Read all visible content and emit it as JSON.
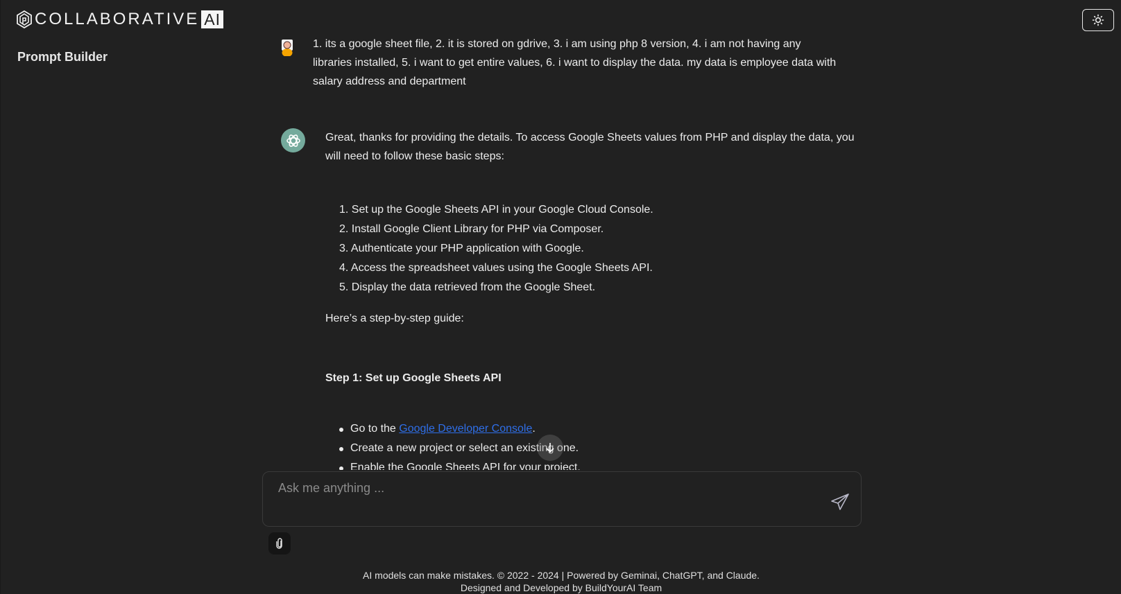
{
  "header": {
    "logo_text": "COLLABORATIVE",
    "logo_badge": "AI",
    "sidebar_title": "Prompt Builder",
    "theme_toggle_icon": "sun-icon"
  },
  "conversation": {
    "user_message": {
      "avatar_icon": "user-avatar-icon",
      "text": "1. its a google sheet file, 2. it is stored on gdrive, 3. i am using php 8 version, 4. i am not having any libraries installed, 5. i want to get entire values, 6. i want to display the data. my data is employee data with salary address and department"
    },
    "assistant_message": {
      "avatar_icon": "openai-logo-icon",
      "intro": "Great, thanks for providing the details. To access Google Sheets values from PHP and display the data, you will need to follow these basic steps:",
      "steps": [
        "1. Set up the Google Sheets API in your Google Cloud Console.",
        "2. Install Google Client Library for PHP via Composer.",
        "3. Authenticate your PHP application with Google.",
        "4. Access the spreadsheet values using the Google Sheets API.",
        "5. Display the data retrieved from the Google Sheet."
      ],
      "guide_intro": "Here’s a step-by-step guide:",
      "step1_heading": "Step 1: Set up Google Sheets API",
      "step1_bullets": {
        "b1_prefix": "Go to the ",
        "b1_link": "Google Developer Console",
        "b1_suffix": ".",
        "b2": "Create a new project or select an existing one.",
        "b3": "Enable the Google Sheets API for your project."
      }
    }
  },
  "composer": {
    "placeholder": "Ask me anything ...",
    "value": "",
    "send_icon": "send-icon",
    "attach_icon": "paperclip-icon"
  },
  "footer": {
    "line1": "AI models can make mistakes. © 2022 - 2024 | Powered by Geminai, ChatGPT, and Claude.",
    "line2": "Designed and Developed by BuildYourAI Team"
  },
  "colors": {
    "background": "#212121",
    "link": "#2f6fe9",
    "assistant_avatar": "#74aa9c",
    "user_avatar": "#f5a400"
  }
}
